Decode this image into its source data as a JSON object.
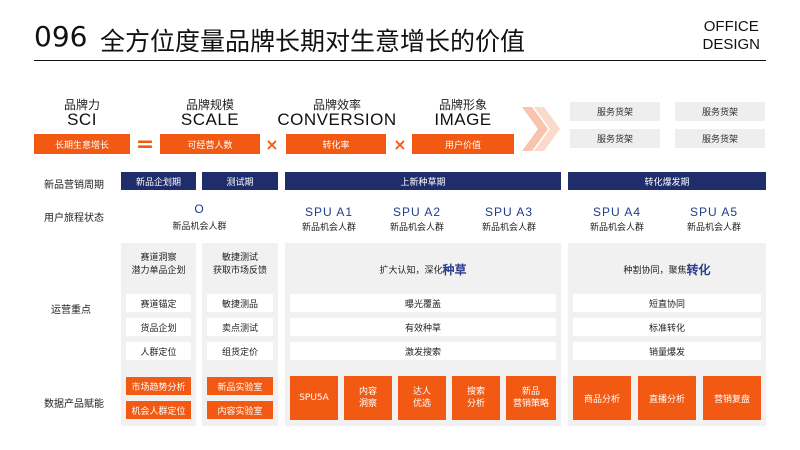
{
  "header": {
    "number": "096",
    "title": "全方位度量品牌长期对生意增长的价值",
    "brand_line1": "OFFICE",
    "brand_line2": "DESIGN"
  },
  "formula": {
    "terms": [
      {
        "cn": "品牌力",
        "en": "SCI",
        "box": "长期生意增长"
      },
      {
        "cn": "品牌规模",
        "en": "SCALE",
        "box": "可经营人数"
      },
      {
        "cn": "品牌效率",
        "en": "CONVERSION",
        "box": "转化率"
      },
      {
        "cn": "品牌形象",
        "en": "IMAGE",
        "box": "用户价值"
      }
    ],
    "ops": [
      "=",
      "×",
      "×"
    ],
    "shelves": [
      "服务货架",
      "服务货架",
      "服务货架",
      "服务货架"
    ]
  },
  "rows": {
    "cycle": "新品营销周期",
    "journey": "用户旅程状态",
    "ops": "运营重点",
    "data": "数据产品赋能"
  },
  "phases": [
    "新品企划期",
    "测试期",
    "上新种草期",
    "转化爆发期"
  ],
  "journey": {
    "o": {
      "en": "O",
      "cn": "新品机会人群"
    },
    "spus": [
      {
        "en": "SPU A1",
        "cn": "新品机会人群"
      },
      {
        "en": "SPU A2",
        "cn": "新品机会人群"
      },
      {
        "en": "SPU A3",
        "cn": "新品机会人群"
      },
      {
        "en": "SPU A4",
        "cn": "新品机会人群"
      },
      {
        "en": "SPU A5",
        "cn": "新品机会人群"
      }
    ]
  },
  "ops_focus": {
    "col1": {
      "head1": "赛道洞察",
      "head2": "潜力单品企划",
      "items": [
        "赛道锚定",
        "货品企划",
        "人群定位"
      ]
    },
    "col2": {
      "head1": "敏捷测试",
      "head2": "获取市场反馈",
      "items": [
        "敏捷测品",
        "卖点测试",
        "组货定价"
      ]
    },
    "col3": {
      "head_pre": "扩大认知，深化",
      "head_accent": "种草",
      "items": [
        "曝光覆盖",
        "有效种草",
        "激发搜索"
      ]
    },
    "col4": {
      "head_pre": "种割协同，聚焦",
      "head_accent": "转化",
      "items": [
        "短直协同",
        "标准转化",
        "销量爆发"
      ]
    }
  },
  "data_products": {
    "col1": [
      "市场趋势分析",
      "机会人群定位"
    ],
    "col2": [
      "新品实验室",
      "内容实验室"
    ],
    "col3": [
      "SPU5A",
      "内容\n洞察",
      "达人\n优选",
      "搜索\n分析",
      "新品\n营销策略"
    ],
    "col4": [
      "商品分析",
      "直播分析",
      "营销复盘"
    ]
  }
}
